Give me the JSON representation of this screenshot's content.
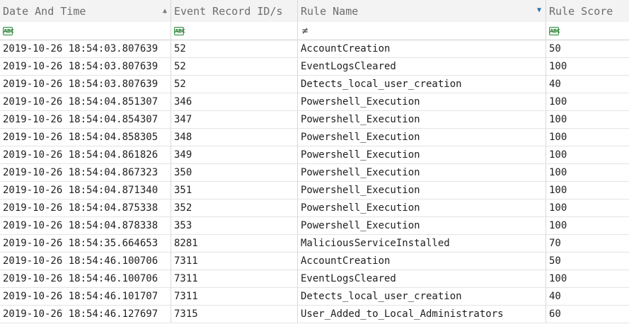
{
  "columns": [
    {
      "label": "Date And Time",
      "sort": "ascending"
    },
    {
      "label": "Event Record ID/s"
    },
    {
      "label": "Rule Name",
      "filtered": true
    },
    {
      "label": "Rule Score"
    }
  ],
  "filter_row": {
    "date_time": "abc-filter-icon",
    "record_id": "abc-filter-icon",
    "rule_name": "≠",
    "rule_score": "abc-filter-icon"
  },
  "rows": [
    {
      "datetime": "2019-10-26 18:54:03.807639",
      "record_id": "52",
      "rule": "AccountCreation",
      "score": "50"
    },
    {
      "datetime": "2019-10-26 18:54:03.807639",
      "record_id": "52",
      "rule": "EventLogsCleared",
      "score": "100"
    },
    {
      "datetime": "2019-10-26 18:54:03.807639",
      "record_id": "52",
      "rule": "Detects_local_user_creation",
      "score": "40"
    },
    {
      "datetime": "2019-10-26 18:54:04.851307",
      "record_id": "346",
      "rule": "Powershell_Execution",
      "score": "100"
    },
    {
      "datetime": "2019-10-26 18:54:04.854307",
      "record_id": "347",
      "rule": "Powershell_Execution",
      "score": "100"
    },
    {
      "datetime": "2019-10-26 18:54:04.858305",
      "record_id": "348",
      "rule": "Powershell_Execution",
      "score": "100"
    },
    {
      "datetime": "2019-10-26 18:54:04.861826",
      "record_id": "349",
      "rule": "Powershell_Execution",
      "score": "100"
    },
    {
      "datetime": "2019-10-26 18:54:04.867323",
      "record_id": "350",
      "rule": "Powershell_Execution",
      "score": "100"
    },
    {
      "datetime": "2019-10-26 18:54:04.871340",
      "record_id": "351",
      "rule": "Powershell_Execution",
      "score": "100"
    },
    {
      "datetime": "2019-10-26 18:54:04.875338",
      "record_id": "352",
      "rule": "Powershell_Execution",
      "score": "100"
    },
    {
      "datetime": "2019-10-26 18:54:04.878338",
      "record_id": "353",
      "rule": "Powershell_Execution",
      "score": "100"
    },
    {
      "datetime": "2019-10-26 18:54:35.664653",
      "record_id": "8281",
      "rule": "MaliciousServiceInstalled",
      "score": "70"
    },
    {
      "datetime": "2019-10-26 18:54:46.100706",
      "record_id": "7311",
      "rule": "AccountCreation",
      "score": "50"
    },
    {
      "datetime": "2019-10-26 18:54:46.100706",
      "record_id": "7311",
      "rule": "EventLogsCleared",
      "score": "100"
    },
    {
      "datetime": "2019-10-26 18:54:46.101707",
      "record_id": "7311",
      "rule": "Detects_local_user_creation",
      "score": "40"
    },
    {
      "datetime": "2019-10-26 18:54:46.127697",
      "record_id": "7315",
      "rule": "User_Added_to_Local_Administrators",
      "score": "60"
    }
  ]
}
